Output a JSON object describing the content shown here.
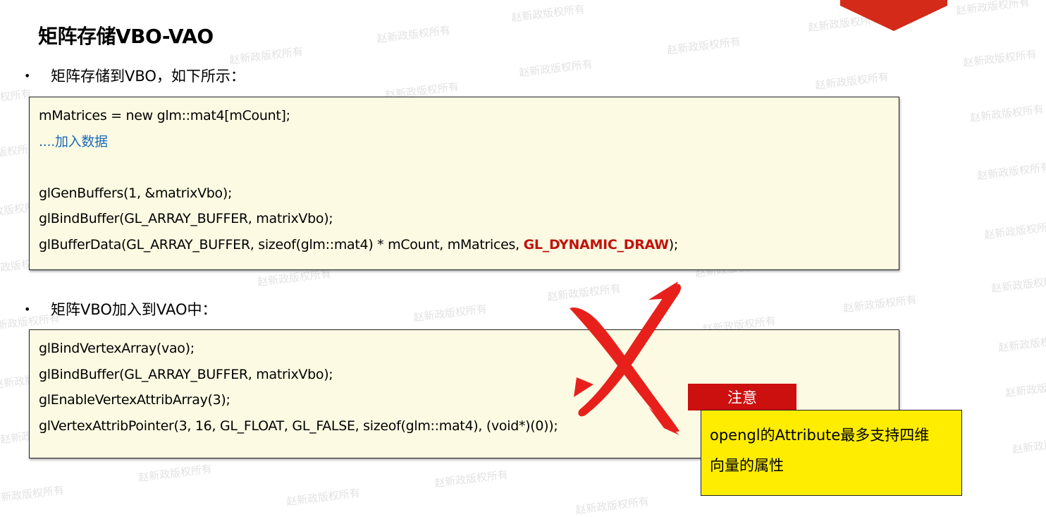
{
  "slide": {
    "title": "矩阵存储VBO-VAO"
  },
  "section1": {
    "bullet_symbol": "•",
    "bullet_text": "矩阵存储到VBO，如下所示：",
    "code_lines": [
      "mMatrices = new glm::mat4[mCount];",
      "....加入数据",
      "",
      "glGenBuffers(1, &matrixVbo);",
      "glBindBuffer(GL_ARRAY_BUFFER, matrixVbo);"
    ],
    "last_line_prefix": "glBufferData(GL_ARRAY_BUFFER, sizeof(glm::mat4) * mCount, mMatrices, ",
    "last_line_highlight": "GL_DYNAMIC_DRAW",
    "last_line_suffix": ");"
  },
  "section2": {
    "bullet_symbol": "•",
    "bullet_text": "矩阵VBO加入到VAO中：",
    "code_lines": [
      "glBindVertexArray(vao);",
      "glBindBuffer(GL_ARRAY_BUFFER, matrixVbo);",
      "glEnableVertexAttribArray(3);",
      "glVertexAttribPointer(3, 16, GL_FLOAT, GL_FALSE, sizeof(glm::mat4), (void*)(0));"
    ]
  },
  "note": {
    "tag": "注意",
    "line1": "opengl的Attribute最多支持四维",
    "line2": "向量的属性"
  },
  "watermark_text": "赵新政版权所有",
  "colors": {
    "code_background": "#fdfae3",
    "comment": "#1a6ab8",
    "highlight": "#c0140c",
    "cross": "#e8201c",
    "note_tag": "#cc0f0f",
    "note_box": "#ffed00",
    "corner_accent": "#d42a1a"
  }
}
